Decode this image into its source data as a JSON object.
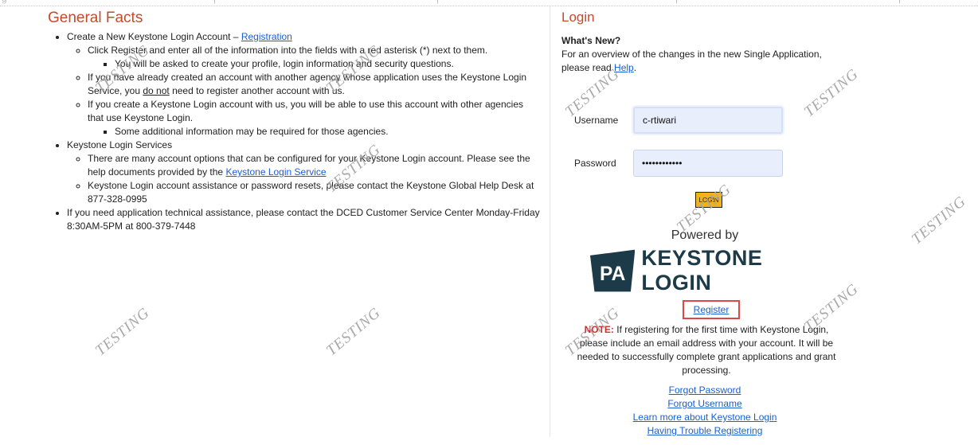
{
  "general": {
    "heading": "General Facts",
    "items": [
      {
        "text": "Create a New Keystone Login Account – ",
        "link": "Registration",
        "sub": [
          {
            "text": "Click Register and enter all of the information into the fields with a red asterisk (*) next to them.",
            "sub": [
              "You will be asked to create your profile, login information and security questions."
            ]
          },
          {
            "pre": "If you have already created an account with another agency whose application uses the Keystone Login Service, you ",
            "em": "do not",
            "post": " need to register another account with us."
          },
          {
            "text": "If you create a Keystone Login account with us, you will be able to use this account with other agencies that use Keystone Login.",
            "sub": [
              "Some additional information may be required for those agencies."
            ]
          }
        ]
      },
      {
        "text": "Keystone Login Services",
        "sub": [
          {
            "pre": "There are many account options that can be configured for your Keystone Login account. Please see the help documents provided by the ",
            "link": "Keystone Login Service"
          },
          {
            "text": "Keystone Login account assistance or password resets, please contact the Keystone Global Help Desk at 877-328-0995"
          }
        ]
      },
      {
        "text": "If you need application technical assistance, please contact the DCED Customer Service Center Monday-Friday 8:30AM-5PM at 800-379-7448"
      }
    ]
  },
  "login": {
    "title": "Login",
    "whats_new_heading": "What's New?",
    "whats_new_text": "For an overview of the changes in the new Single Application, please read ",
    "whats_new_link": "Help",
    "whats_new_end": ".",
    "username_label": "Username",
    "username_value": "c-rtiwari",
    "password_label": "Password",
    "password_value": "••••••••••••",
    "login_button": "LOGIN",
    "powered_by": "Powered by",
    "logo_mark": "PA",
    "logo_text": "KEYSTONE LOGIN",
    "register_link": "Register",
    "note_label": "NOTE:",
    "note_text": " If registering for the first time with Keystone Login, please include an email address with your account. It will be needed to successfully complete grant applications and grant processing.",
    "links": [
      "Forgot Password",
      "Forgot Username",
      "Learn more about Keystone Login",
      "Having Trouble Registering"
    ]
  },
  "watermark": "TESTING",
  "top_fragments": [
    "g",
    "|",
    "|",
    "|",
    "|",
    "|",
    "|",
    "|"
  ]
}
